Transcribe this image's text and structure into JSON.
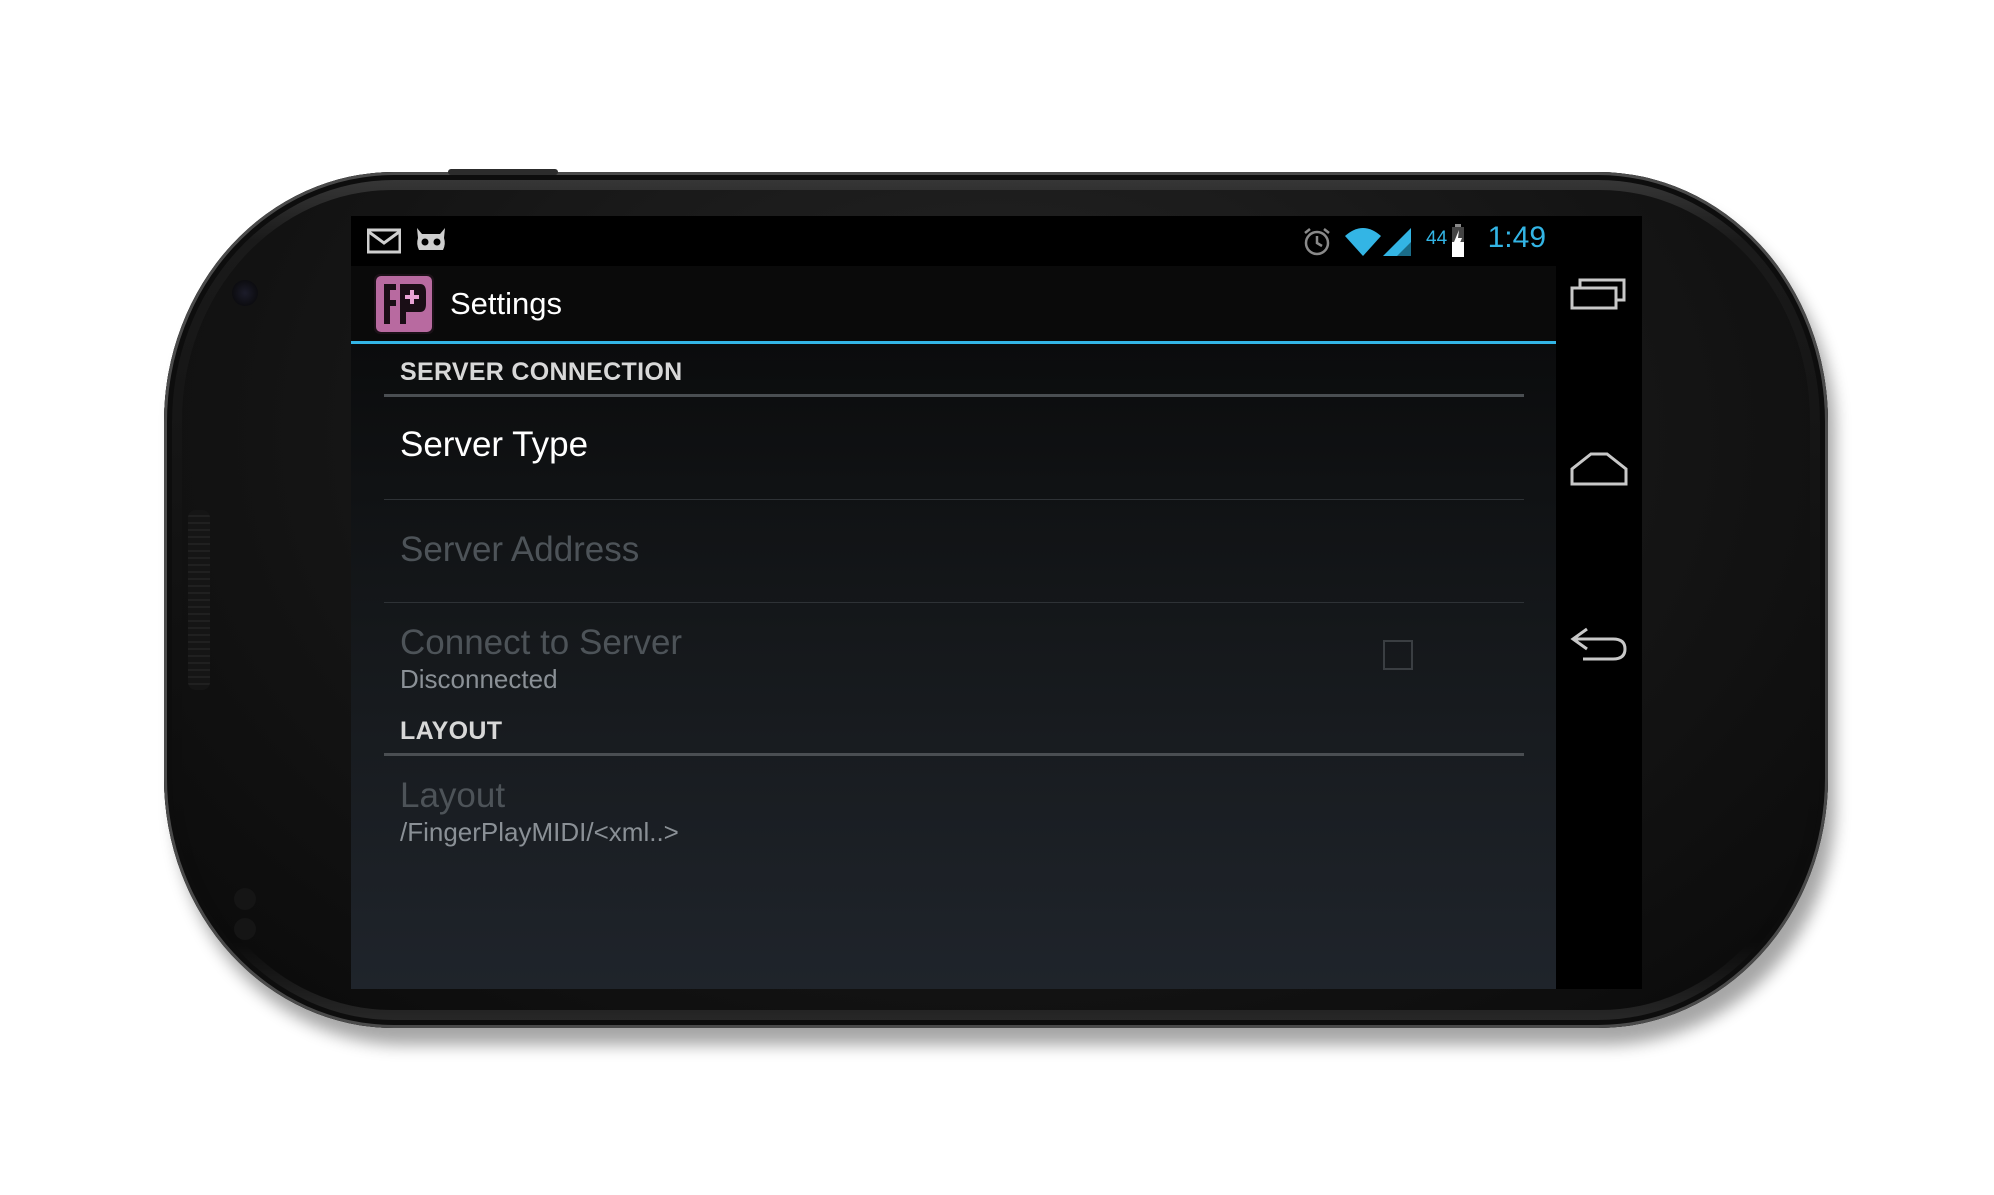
{
  "status_bar": {
    "notification_icons": [
      "gmail-icon",
      "cyanogen-icon"
    ],
    "system_icons": [
      "alarm-icon",
      "wifi-icon",
      "signal-icon",
      "battery-icon"
    ],
    "battery_percent": "44",
    "time": "1:49",
    "accent_color": "#33b5e5"
  },
  "action_bar": {
    "app_icon": "fingerplay-app-icon",
    "title": "Settings"
  },
  "settings": {
    "server_connection": {
      "header": "SERVER CONNECTION",
      "server_type": {
        "title": "Server Type"
      },
      "server_address": {
        "title": "Server Address"
      },
      "connect_to_server": {
        "title": "Connect to Server",
        "summary": "Disconnected",
        "checked": false
      }
    },
    "layout": {
      "header": "LAYOUT",
      "layout_pref": {
        "title": "Layout",
        "summary": "/FingerPlayMIDI/<xml..>"
      }
    }
  },
  "nav_bar": {
    "buttons": [
      "recent-apps-icon",
      "home-icon",
      "back-icon"
    ]
  }
}
